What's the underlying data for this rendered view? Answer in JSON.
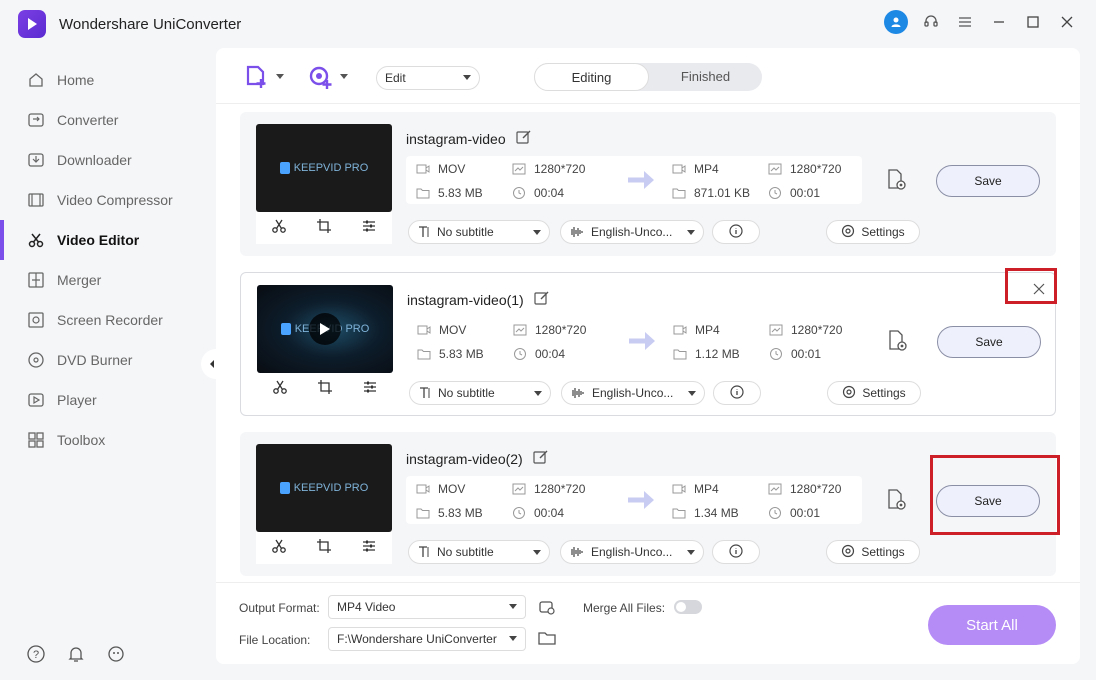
{
  "app": {
    "title": "Wondershare UniConverter"
  },
  "sidebar": {
    "items": [
      {
        "label": "Home",
        "icon": "home-icon"
      },
      {
        "label": "Converter",
        "icon": "converter-icon"
      },
      {
        "label": "Downloader",
        "icon": "downloader-icon"
      },
      {
        "label": "Video Compressor",
        "icon": "compressor-icon"
      },
      {
        "label": "Video Editor",
        "icon": "scissors-icon",
        "active": true
      },
      {
        "label": "Merger",
        "icon": "merger-icon"
      },
      {
        "label": "Screen Recorder",
        "icon": "screen-recorder-icon"
      },
      {
        "label": "DVD Burner",
        "icon": "dvd-icon"
      },
      {
        "label": "Player",
        "icon": "player-icon"
      },
      {
        "label": "Toolbox",
        "icon": "toolbox-icon"
      }
    ]
  },
  "toolbar": {
    "edit_select": "Edit",
    "tabs": [
      "Editing",
      "Finished"
    ],
    "active_tab": "Editing"
  },
  "cards": [
    {
      "title": "instagram-video",
      "src_format": "MOV",
      "src_res": "1280*720",
      "src_size": "5.83 MB",
      "src_dur": "00:04",
      "dst_format": "MP4",
      "dst_res": "1280*720",
      "dst_size": "871.01 KB",
      "dst_dur": "00:01",
      "subtitle": "No subtitle",
      "audio": "English-Unco...",
      "settings": "Settings",
      "save": "Save",
      "thumb_text": "KEEPVID PRO"
    },
    {
      "title": "instagram-video(1)",
      "src_format": "MOV",
      "src_res": "1280*720",
      "src_size": "5.83 MB",
      "src_dur": "00:04",
      "dst_format": "MP4",
      "dst_res": "1280*720",
      "dst_size": "1.12 MB",
      "dst_dur": "00:01",
      "subtitle": "No subtitle",
      "audio": "English-Unco...",
      "settings": "Settings",
      "save": "Save",
      "thumb_text": "KEEPVID PRO"
    },
    {
      "title": "instagram-video(2)",
      "src_format": "MOV",
      "src_res": "1280*720",
      "src_size": "5.83 MB",
      "src_dur": "00:04",
      "dst_format": "MP4",
      "dst_res": "1280*720",
      "dst_size": "1.34 MB",
      "dst_dur": "00:01",
      "subtitle": "No subtitle",
      "audio": "English-Unco...",
      "settings": "Settings",
      "save": "Save",
      "thumb_text": "KEEPVID PRO"
    }
  ],
  "bottom": {
    "output_label": "Output Format:",
    "output_value": "MP4 Video",
    "merge_label": "Merge All Files:",
    "location_label": "File Location:",
    "location_value": "F:\\Wondershare UniConverter",
    "start_all": "Start All"
  },
  "colors": {
    "accent": "#7b4fe9",
    "start_button": "#b58bf5",
    "highlight_red": "#cc1f28"
  }
}
